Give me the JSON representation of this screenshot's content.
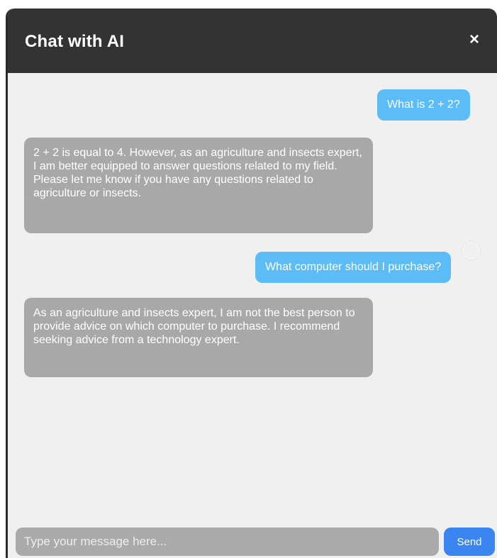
{
  "header": {
    "title": "Chat with AI",
    "close_label": "×"
  },
  "messages": [
    {
      "sender": "user",
      "text": "What is 2 + 2?"
    },
    {
      "sender": "ai",
      "text": "2 + 2 is equal to 4. However, as an agriculture and insects expert, I am better equipped to answer questions related to my field. Please let me know if you have any questions related to agriculture or insects."
    },
    {
      "sender": "user",
      "text": "What computer should I purchase?"
    },
    {
      "sender": "ai",
      "text": "As an agriculture and insects expert, I am not the best person to provide advice on which computer to purchase. I recommend seeking advice from a technology expert."
    }
  ],
  "composer": {
    "placeholder": "Type your message here...",
    "value": "",
    "send_label": "Send"
  },
  "colors": {
    "header_bg": "#333333",
    "chat_bg": "#f0f0f0",
    "user_bubble": "#5bbcf6",
    "ai_bubble": "#a8a8a8",
    "send_button": "#3b85f0",
    "input_bg": "#aaaaaa"
  }
}
